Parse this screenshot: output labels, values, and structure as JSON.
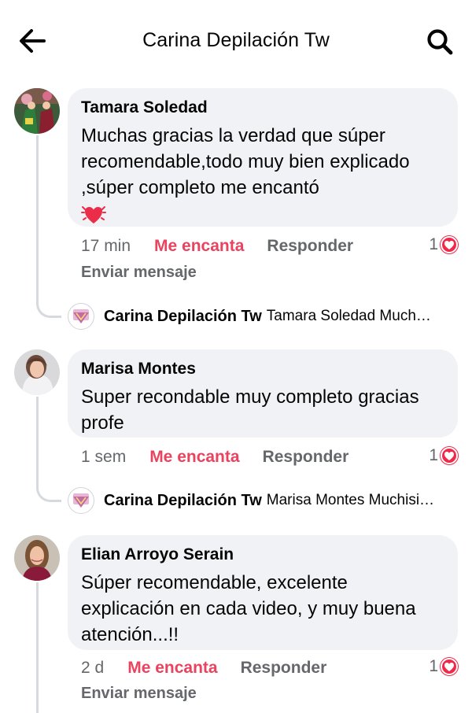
{
  "header": {
    "title": "Carina Depilación Tw",
    "back_icon": "arrow-left-icon",
    "search_icon": "search-icon"
  },
  "colors": {
    "accent_love": "#e8435f",
    "bubble_bg": "#f0f2f5",
    "muted_text": "#65676b",
    "heart_badge": "#f0284a"
  },
  "comments": [
    {
      "author": "Tamara Soledad",
      "text": "Muchas gracias la verdad que súper recomendable,todo muy bien explicado ,súper completo me encantó",
      "emoji": "beating-heart-emoji",
      "time": "17 min",
      "love_label": "Me encanta",
      "reply_label": "Responder",
      "reaction_count": "1",
      "message_label": "Enviar mensaje",
      "reply_preview": {
        "author": "Carina Depilación Tw",
        "snippet": "Tamara Soledad Much…"
      }
    },
    {
      "author": "Marisa Montes",
      "text": "Super recondable muy completo gracias profe",
      "time": "1 sem",
      "love_label": "Me encanta",
      "reply_label": "Responder",
      "reaction_count": "1",
      "reply_preview": {
        "author": "Carina Depilación Tw",
        "snippet": "Marisa Montes Muchisi…"
      }
    },
    {
      "author": "Elian Arroyo Serain",
      "text": "Súper recomendable, excelente explicación en cada video, y muy buena atención...!!",
      "time": "2 d",
      "love_label": "Me encanta",
      "reply_label": "Responder",
      "reaction_count": "1",
      "message_label": "Enviar mensaje"
    }
  ]
}
